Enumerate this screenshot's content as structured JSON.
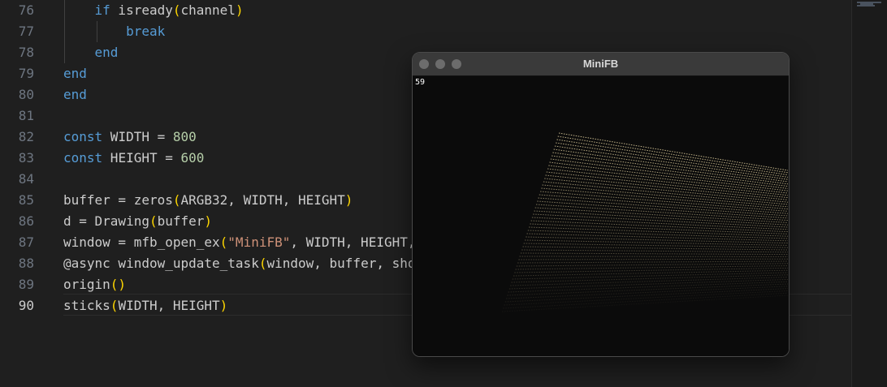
{
  "editor": {
    "lines": [
      {
        "number": "76",
        "indent": "    ",
        "tokens": [
          {
            "t": "if",
            "c": "kw"
          },
          {
            "t": " isready",
            "c": ""
          },
          {
            "t": "(",
            "c": "br"
          },
          {
            "t": "channel",
            "c": ""
          },
          {
            "t": ")",
            "c": "br"
          }
        ]
      },
      {
        "number": "77",
        "indent": "        ",
        "tokens": [
          {
            "t": "break",
            "c": "kw"
          }
        ]
      },
      {
        "number": "78",
        "indent": "    ",
        "tokens": [
          {
            "t": "end",
            "c": "kw"
          }
        ]
      },
      {
        "number": "79",
        "indent": "",
        "tokens": [
          {
            "t": "end",
            "c": "kw"
          }
        ]
      },
      {
        "number": "80",
        "indent": "",
        "tokens": [
          {
            "t": "end",
            "c": "kw"
          }
        ]
      },
      {
        "number": "81",
        "indent": "",
        "tokens": []
      },
      {
        "number": "82",
        "indent": "",
        "tokens": [
          {
            "t": "const",
            "c": "kw"
          },
          {
            "t": " WIDTH = ",
            "c": ""
          },
          {
            "t": "800",
            "c": "num"
          }
        ]
      },
      {
        "number": "83",
        "indent": "",
        "tokens": [
          {
            "t": "const",
            "c": "kw"
          },
          {
            "t": " HEIGHT = ",
            "c": ""
          },
          {
            "t": "600",
            "c": "num"
          }
        ]
      },
      {
        "number": "84",
        "indent": "",
        "tokens": []
      },
      {
        "number": "85",
        "indent": "",
        "tokens": [
          {
            "t": "buffer = zeros",
            "c": ""
          },
          {
            "t": "(",
            "c": "br"
          },
          {
            "t": "ARGB32, WIDTH, HEIGHT",
            "c": ""
          },
          {
            "t": ")",
            "c": "br"
          }
        ]
      },
      {
        "number": "86",
        "indent": "",
        "tokens": [
          {
            "t": "d = Drawing",
            "c": ""
          },
          {
            "t": "(",
            "c": "br"
          },
          {
            "t": "buffer",
            "c": ""
          },
          {
            "t": ")",
            "c": "br"
          }
        ]
      },
      {
        "number": "87",
        "indent": "",
        "tokens": [
          {
            "t": "window = mfb_open_ex",
            "c": ""
          },
          {
            "t": "(",
            "c": "br"
          },
          {
            "t": "\"MiniFB\"",
            "c": "str"
          },
          {
            "t": ", WIDTH, HEIGHT, MFB_RESIZABLE",
            "c": ""
          },
          {
            "t": ")",
            "c": "br"
          }
        ]
      },
      {
        "number": "88",
        "indent": "",
        "tokens": [
          {
            "t": "@async window_update_task",
            "c": ""
          },
          {
            "t": "(",
            "c": "br"
          },
          {
            "t": "window, buffer, showFPS",
            "c": ""
          },
          {
            "t": ")",
            "c": "br"
          }
        ]
      },
      {
        "number": "89",
        "indent": "",
        "tokens": [
          {
            "t": "origin",
            "c": ""
          },
          {
            "t": "()",
            "c": "br"
          }
        ]
      },
      {
        "number": "90",
        "indent": "",
        "tokens": [
          {
            "t": "sticks",
            "c": ""
          },
          {
            "t": "(",
            "c": "br"
          },
          {
            "t": "WIDTH, HEIGHT",
            "c": ""
          },
          {
            "t": ")",
            "c": "br"
          }
        ]
      }
    ],
    "active_line": "90"
  },
  "minifb_window": {
    "title": "MiniFB",
    "fps": "59",
    "stick_count": 56,
    "stick_color": "#d8c898",
    "background": "#0b0b0b"
  },
  "colors": {
    "editor_bg": "#1f1f1f",
    "keyword": "#569cd6",
    "bracket": "#ffd700",
    "number": "#b5cea8",
    "string": "#ce9178"
  }
}
